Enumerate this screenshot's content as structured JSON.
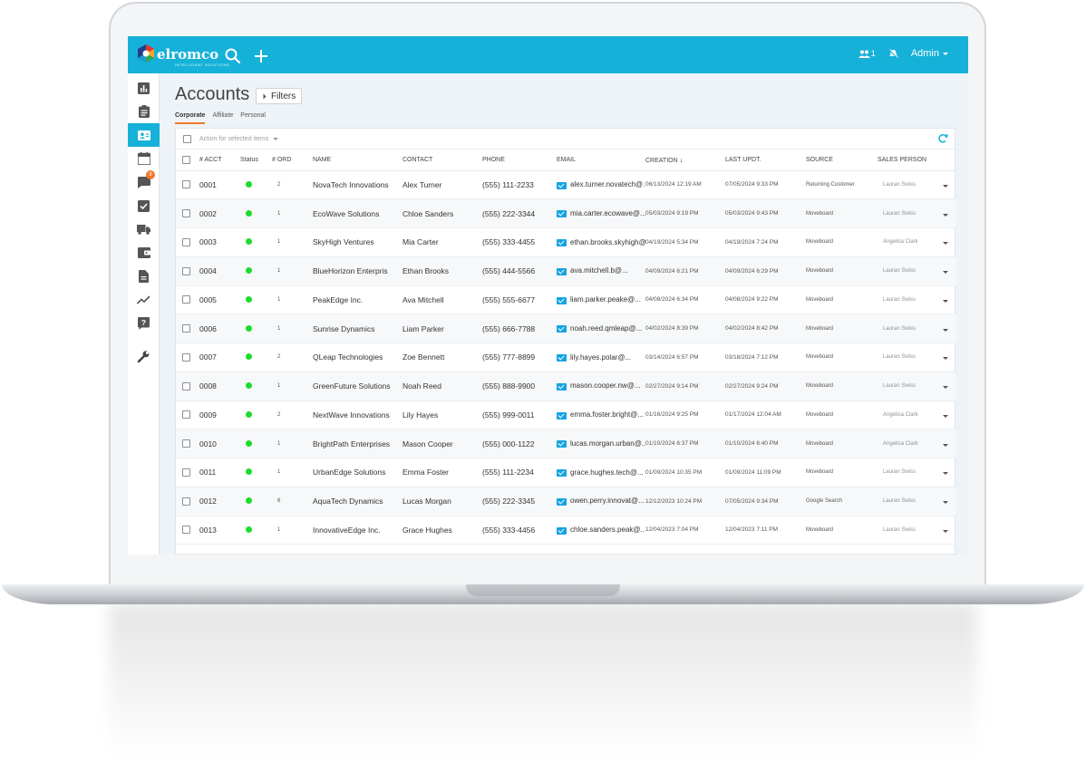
{
  "app": {
    "brand": "elromco",
    "brand_sub": "INTELLIGENT SOLUTIONS",
    "accent": "#16b1d9",
    "badge_color": "#f0772b"
  },
  "topbar": {
    "search_icon": "search-icon",
    "add_icon": "plus-icon",
    "users_count": "1",
    "user_label": "Admin"
  },
  "sidebar": {
    "items": [
      {
        "icon": "chart-icon",
        "active": false
      },
      {
        "icon": "clipboard-icon",
        "active": false
      },
      {
        "icon": "contact-card-icon",
        "active": true
      },
      {
        "icon": "calendar-icon",
        "active": false
      },
      {
        "icon": "chat-icon",
        "active": false,
        "badge": "9"
      },
      {
        "icon": "checkbox-icon",
        "active": false
      },
      {
        "icon": "truck-icon",
        "active": false
      },
      {
        "icon": "wallet-icon",
        "active": false
      },
      {
        "icon": "document-icon",
        "active": false
      },
      {
        "icon": "trend-icon",
        "active": false
      },
      {
        "icon": "help-icon",
        "active": false
      },
      {
        "icon": "wrench-icon",
        "active": false
      }
    ]
  },
  "page": {
    "title": "Accounts",
    "filters_label": "Filters",
    "tabs": [
      "Corporate",
      "Affiliate",
      "Personal"
    ],
    "action_placeholder": "Action for selected items"
  },
  "table": {
    "columns": [
      "# ACCT",
      "Status",
      "# ORD",
      "NAME",
      "CONTACT",
      "PHONE",
      "EMAIL",
      "CREATION",
      "LAST UPDT.",
      "SOURCE",
      "SALES PERSON"
    ],
    "rows": [
      {
        "acct": "0001",
        "ord": "2",
        "name": "NovaTech Innovations",
        "contact": "Alex Turner",
        "phone": "(555) 111-2233",
        "email": "alex.turner.novatech@...",
        "created": "06/13/2024 12:19 AM",
        "updated": "07/05/2024 9:33 PM",
        "source": "Returning Customer",
        "sales": "Lauran Swiss"
      },
      {
        "acct": "0002",
        "ord": "1",
        "name": "EcoWave Solutions",
        "contact": "Chloe Sanders",
        "phone": "(555) 222-3344",
        "email": "mia.carter.ecowave@...",
        "created": "05/03/2024 9:19 PM",
        "updated": "05/03/2024 9:43 PM",
        "source": "Moveboard",
        "sales": "Lauran Swiss"
      },
      {
        "acct": "0003",
        "ord": "1",
        "name": "SkyHigh Ventures",
        "contact": "Mia Carter",
        "phone": "(555) 333-4455",
        "email": "ethan.brooks.skyhigh@...",
        "created": "04/19/2024 5:34 PM",
        "updated": "04/19/2024 7:24 PM",
        "source": "Moveboard",
        "sales": "Angelica Clark"
      },
      {
        "acct": "0004",
        "ord": "1",
        "name": "BlueHorizon Enterpris",
        "contact": "Ethan Brooks",
        "phone": "(555) 444-5566",
        "email": "ava.mitchell.b@...",
        "created": "04/09/2024 6:21 PM",
        "updated": "04/09/2024 6:29 PM",
        "source": "Moveboard",
        "sales": "Lauran Swiss"
      },
      {
        "acct": "0005",
        "ord": "1",
        "name": "PeakEdge Inc.",
        "contact": "Ava Mitchell",
        "phone": "(555) 555-6677",
        "email": "liam.parker.peake@...",
        "created": "04/08/2024 6:34 PM",
        "updated": "04/08/2024 9:22 PM",
        "source": "Moveboard",
        "sales": "Lauran Swiss"
      },
      {
        "acct": "0006",
        "ord": "1",
        "name": "Sunrise Dynamics",
        "contact": "Liam Parker",
        "phone": "(555) 666-7788",
        "email": "noah.reed.qmleap@...",
        "created": "04/02/2024 8:39 PM",
        "updated": "04/02/2024 8:42 PM",
        "source": "Moveboard",
        "sales": "Lauran Swiss"
      },
      {
        "acct": "0007",
        "ord": "2",
        "name": "QLeap Technologies",
        "contact": "Zoe Bennett",
        "phone": "(555) 777-8899",
        "email": "lily.hayes.polar@...",
        "created": "03/14/2024 6:57 PM",
        "updated": "03/18/2024 7:12 PM",
        "source": "Moveboard",
        "sales": "Lauran Swiss"
      },
      {
        "acct": "0008",
        "ord": "1",
        "name": "GreenFuture Solutions",
        "contact": "Noah Reed",
        "phone": "(555) 888-9900",
        "email": "mason.cooper.nw@...",
        "created": "02/27/2024 9:14 PM",
        "updated": "02/27/2024 9:24 PM",
        "source": "Moveboard",
        "sales": "Lauran Swiss"
      },
      {
        "acct": "0009",
        "ord": "2",
        "name": "NextWave Innovations",
        "contact": "Lily Hayes",
        "phone": "(555) 999-0011",
        "email": "emma.foster.bright@...",
        "created": "01/16/2024 9:25 PM",
        "updated": "01/17/2024 12:04 AM",
        "source": "Moveboard",
        "sales": "Angelica Clark"
      },
      {
        "acct": "0010",
        "ord": "1",
        "name": "BrightPath Enterprises",
        "contact": "Mason Cooper",
        "phone": "(555) 000-1122",
        "email": "lucas.morgan.urban@...",
        "created": "01/10/2024 6:37 PM",
        "updated": "01/10/2024 6:40 PM",
        "source": "Moveboard",
        "sales": "Angelica Clark"
      },
      {
        "acct": "0011",
        "ord": "1",
        "name": "UrbanEdge Solutions",
        "contact": "Emma Foster",
        "phone": "(555) 111-2234",
        "email": "grace.hughes.tech@...",
        "created": "01/09/2024 10:35 PM",
        "updated": "01/09/2024 11:09 PM",
        "source": "Moveboard",
        "sales": "Lauran Swiss"
      },
      {
        "acct": "0012",
        "ord": "6",
        "name": "AquaTech Dynamics",
        "contact": "Lucas Morgan",
        "phone": "(555) 222-3345",
        "email": "owen.perry.innovat@...",
        "created": "12/12/2023 10:24 PM",
        "updated": "07/05/2024 9:34 PM",
        "source": "Google Search",
        "sales": "Lauran Swiss"
      },
      {
        "acct": "0013",
        "ord": "1",
        "name": "InnovativeEdge Inc.",
        "contact": "Grace Hughes",
        "phone": "(555) 333-4456",
        "email": "chloe.sanders.peak@...",
        "created": "12/04/2023 7:04 PM",
        "updated": "12/04/2023 7:11 PM",
        "source": "Moveboard",
        "sales": "Lauran Swiss"
      }
    ]
  }
}
